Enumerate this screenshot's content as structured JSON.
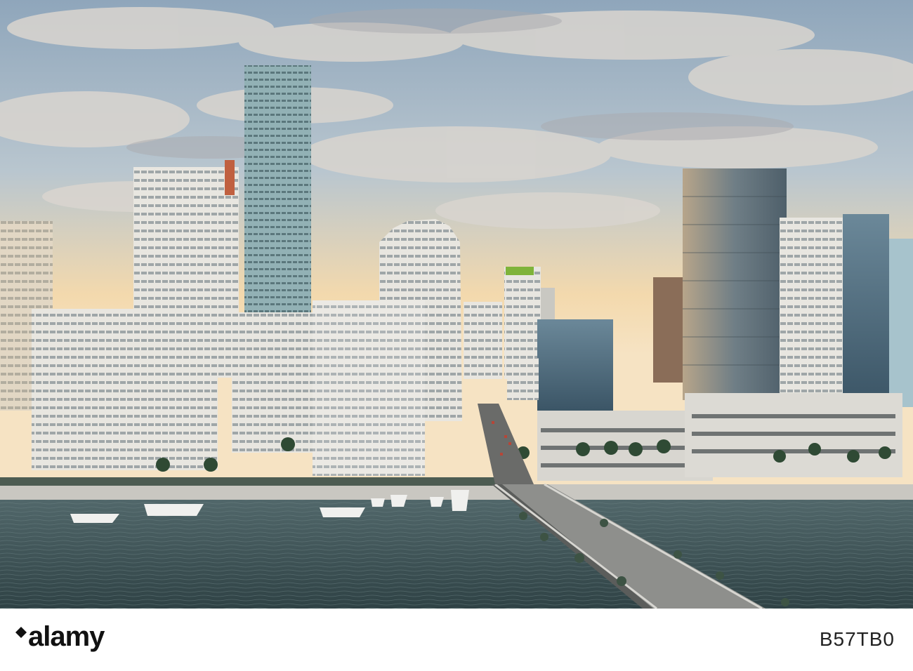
{
  "logo": {
    "text": "alamy"
  },
  "image_id": "B57TB0",
  "colors": {
    "sky_top": "#9fb3c6",
    "sky_glow": "#f2d7a9",
    "water": "#3d5458",
    "building_white": "#e6e4df",
    "glass_blue": "#4f6d80",
    "footer_bg": "#ffffff",
    "logo_text": "#111111"
  },
  "scene": {
    "type": "city-skyline-photo",
    "icons": [
      "cloud-icon",
      "boat-icon",
      "palm-tree-icon",
      "car-icon"
    ]
  }
}
